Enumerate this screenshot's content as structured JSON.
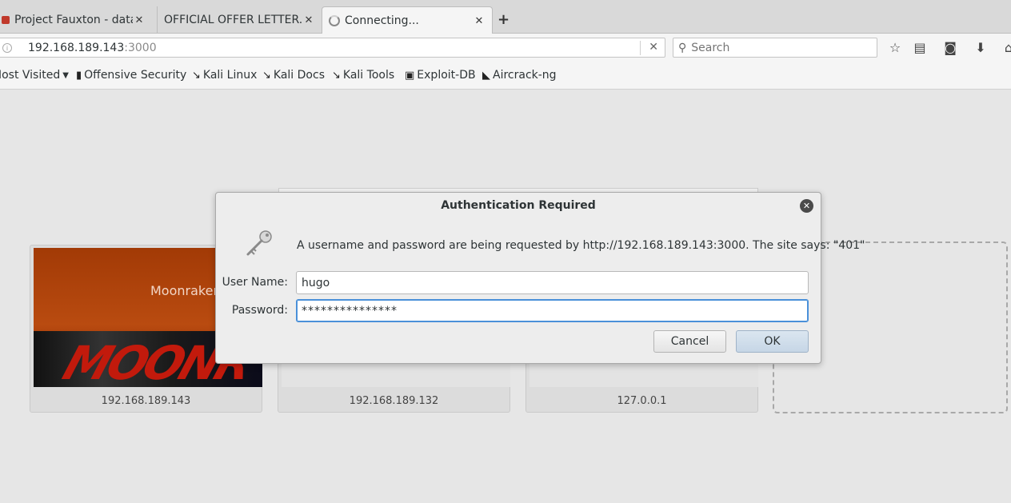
{
  "tabs": [
    {
      "label": "Project Fauxton - data..."
    },
    {
      "label": "OFFICIAL OFFER LETTER..."
    },
    {
      "label": "Connecting..."
    }
  ],
  "url": {
    "host": "192.168.189.143",
    "port": ":3000"
  },
  "search": {
    "placeholder": "Search"
  },
  "bookmarks": {
    "most_visited": "Most Visited",
    "items": [
      "Offensive Security",
      "Kali Linux",
      "Kali Docs",
      "Kali Tools",
      "Exploit-DB",
      "Aircrack-ng"
    ]
  },
  "tiles": [
    {
      "thumb_title": "Moonraker",
      "caption": "192.168.189.143"
    },
    {
      "caption": "192.168.189.132"
    },
    {
      "caption": "127.0.0.1"
    }
  ],
  "dialog": {
    "title": "Authentication Required",
    "message": "A username and password are being requested by http://192.168.189.143:3000. The site says: \"401\"",
    "username_label": "User Name:",
    "username_value": "hugo",
    "password_label": "Password:",
    "password_mask": "***************",
    "cancel_label": "Cancel",
    "ok_label": "OK"
  },
  "colors": {
    "focus": "#4a90d9",
    "moonraker_bg": "#b94b10"
  }
}
